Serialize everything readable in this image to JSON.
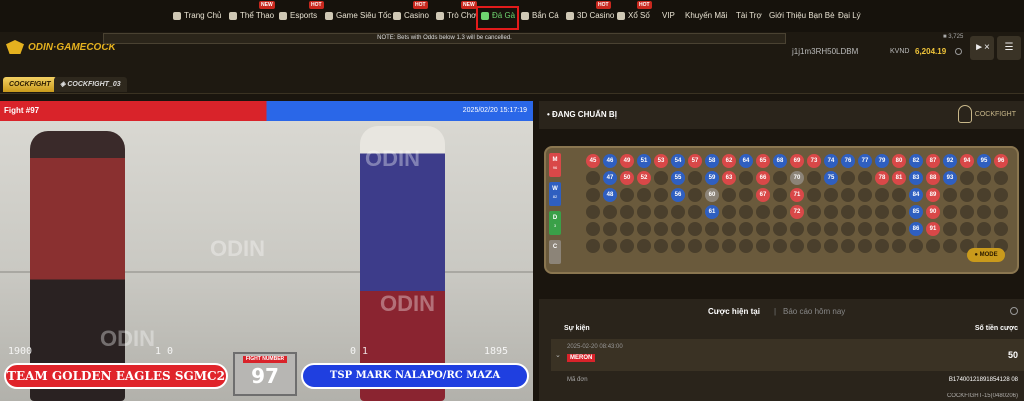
{
  "nav": {
    "items": [
      {
        "label": "Trang Chủ",
        "badge": ""
      },
      {
        "label": "Thể Thao",
        "badge": "NEW"
      },
      {
        "label": "Esports",
        "badge": "HOT"
      },
      {
        "label": "Game Siêu Tốc",
        "badge": ""
      },
      {
        "label": "Casino",
        "badge": "HOT"
      },
      {
        "label": "Trò Chơi",
        "badge": "NEW"
      },
      {
        "label": "Đá Gà",
        "badge": "NEW"
      },
      {
        "label": "Bắn Cá",
        "badge": ""
      },
      {
        "label": "3D Casino",
        "badge": "HOT"
      },
      {
        "label": "Xổ Số",
        "badge": "HOT"
      },
      {
        "label": "VIP",
        "badge": ""
      },
      {
        "label": "Khuyến Mãi",
        "badge": ""
      },
      {
        "label": "Tài Trợ",
        "badge": ""
      },
      {
        "label": "Giới Thiệu Bạn Bè",
        "badge": ""
      },
      {
        "label": "Đại Lý",
        "badge": ""
      }
    ]
  },
  "header": {
    "logo": "ODIN·GAMECOCK",
    "notice": "NOTE: Bets with Odds below 1.3 will be cancelled.",
    "count": "3,725",
    "user_id": "j1j1m3RH50LDBM",
    "currency": "KVND",
    "balance": "6,204.19"
  },
  "tabs": [
    "COCKFIGHT",
    "COCKFIGHT_03"
  ],
  "video": {
    "fight_label": "Fight #97",
    "datetime": "2025/02/20 15:17:19",
    "team_left": "TEAM GOLDEN EAGLES SGMC2",
    "team_right": "TSP MARK NALAPO/RC MAZA",
    "fight_number_label": "FIGHT NUMBER",
    "fight_number": "97",
    "score_left_a": "1900",
    "score_left_b": "1 0",
    "score_right_a": "0 1",
    "score_right_b": "1895",
    "watermark": "ODIN"
  },
  "status": {
    "text": "• ĐANG CHUẨN BỊ",
    "brand": "COCKFIGHT"
  },
  "road": {
    "legend": [
      {
        "letter": "M",
        "count": "96",
        "color": "#d94848"
      },
      {
        "letter": "W",
        "count": "82",
        "color": "#2f5fc0"
      },
      {
        "letter": "D",
        "count": "3",
        "color": "#3aa048"
      },
      {
        "letter": "C",
        "count": "",
        "color": "#8c8478"
      }
    ],
    "mode_label": "MODE",
    "columns": [
      [
        {
          "n": "45",
          "c": "red"
        }
      ],
      [
        {
          "n": "46",
          "c": "blue"
        },
        {
          "n": "47",
          "c": "blue"
        },
        {
          "n": "48",
          "c": "blue"
        }
      ],
      [
        {
          "n": "49",
          "c": "red"
        },
        {
          "n": "50",
          "c": "red"
        }
      ],
      [
        {
          "n": "51",
          "c": "blue"
        },
        {
          "n": "52",
          "c": "red"
        }
      ],
      [
        {
          "n": "53",
          "c": "red"
        }
      ],
      [
        {
          "n": "54",
          "c": "blue"
        },
        {
          "n": "55",
          "c": "blue"
        },
        {
          "n": "56",
          "c": "blue"
        }
      ],
      [
        {
          "n": "57",
          "c": "red"
        }
      ],
      [
        {
          "n": "58",
          "c": "blue"
        },
        {
          "n": "59",
          "c": "blue"
        },
        {
          "n": "60",
          "c": "gray"
        },
        {
          "n": "61",
          "c": "blue"
        }
      ],
      [
        {
          "n": "62",
          "c": "red"
        },
        {
          "n": "63",
          "c": "red"
        }
      ],
      [
        {
          "n": "64",
          "c": "blue"
        }
      ],
      [
        {
          "n": "65",
          "c": "red"
        },
        {
          "n": "66",
          "c": "red"
        },
        {
          "n": "67",
          "c": "red"
        }
      ],
      [
        {
          "n": "68",
          "c": "blue"
        }
      ],
      [
        {
          "n": "69",
          "c": "red"
        },
        {
          "n": "70",
          "c": "gray"
        },
        {
          "n": "71",
          "c": "red"
        },
        {
          "n": "72",
          "c": "red"
        }
      ],
      [
        {
          "n": "73",
          "c": "red"
        }
      ],
      [
        {
          "n": "74",
          "c": "blue"
        },
        {
          "n": "75",
          "c": "blue"
        }
      ],
      [
        {
          "n": "76",
          "c": "blue"
        }
      ],
      [
        {
          "n": "77",
          "c": "blue"
        }
      ],
      [
        {
          "n": "79",
          "c": "blue"
        },
        {
          "n": "78",
          "c": "red"
        }
      ],
      [
        {
          "n": "80",
          "c": "red"
        },
        {
          "n": "81",
          "c": "red"
        }
      ],
      [
        {
          "n": "82",
          "c": "blue"
        },
        {
          "n": "83",
          "c": "blue"
        },
        {
          "n": "84",
          "c": "blue"
        },
        {
          "n": "85",
          "c": "blue"
        },
        {
          "n": "86",
          "c": "blue"
        }
      ],
      [
        {
          "n": "87",
          "c": "red"
        },
        {
          "n": "88",
          "c": "red"
        },
        {
          "n": "89",
          "c": "red"
        },
        {
          "n": "90",
          "c": "red"
        },
        {
          "n": "91",
          "c": "red"
        }
      ],
      [
        {
          "n": "92",
          "c": "blue"
        },
        {
          "n": "93",
          "c": "blue"
        }
      ],
      [
        {
          "n": "94",
          "c": "red"
        }
      ],
      [
        {
          "n": "95",
          "c": "blue"
        }
      ],
      [
        {
          "n": "96",
          "c": "red"
        }
      ]
    ]
  },
  "bets": {
    "tab_current": "Cược hiện tại",
    "tab_divider": "|",
    "tab_today": "Báo cáo hôm nay",
    "col_event": "Sự kiện",
    "col_stake": "Số tiền cược",
    "row": {
      "timestamp": "2025-02-20 08:43:00",
      "side": "MERON",
      "stake": "50",
      "order_label": "Mã đơn",
      "order_value": "B17400121891854128 08",
      "extra_value": "COCKFIGHT-15(0480206)"
    }
  }
}
